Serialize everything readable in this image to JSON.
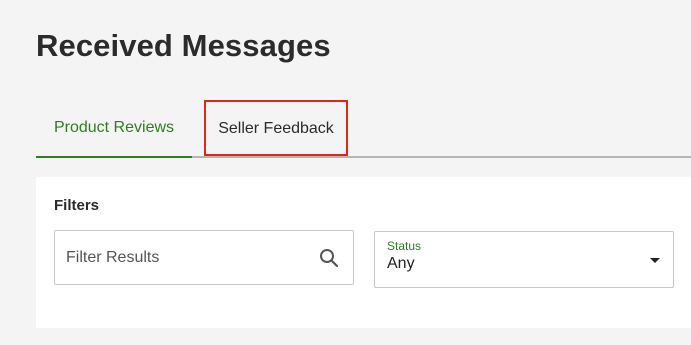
{
  "page": {
    "title": "Received Messages"
  },
  "tabs": {
    "product_reviews": "Product Reviews",
    "seller_feedback": "Seller Feedback"
  },
  "filters": {
    "title": "Filters",
    "search": {
      "placeholder": "Filter Results",
      "value": "",
      "icon": "search-icon"
    },
    "status": {
      "label": "Status",
      "selected": "Any",
      "icon": "caret-down-icon"
    }
  },
  "colors": {
    "accent_green": "#2f7d1f",
    "highlight_red": "#e0251b",
    "background": "#f4f4f4"
  }
}
